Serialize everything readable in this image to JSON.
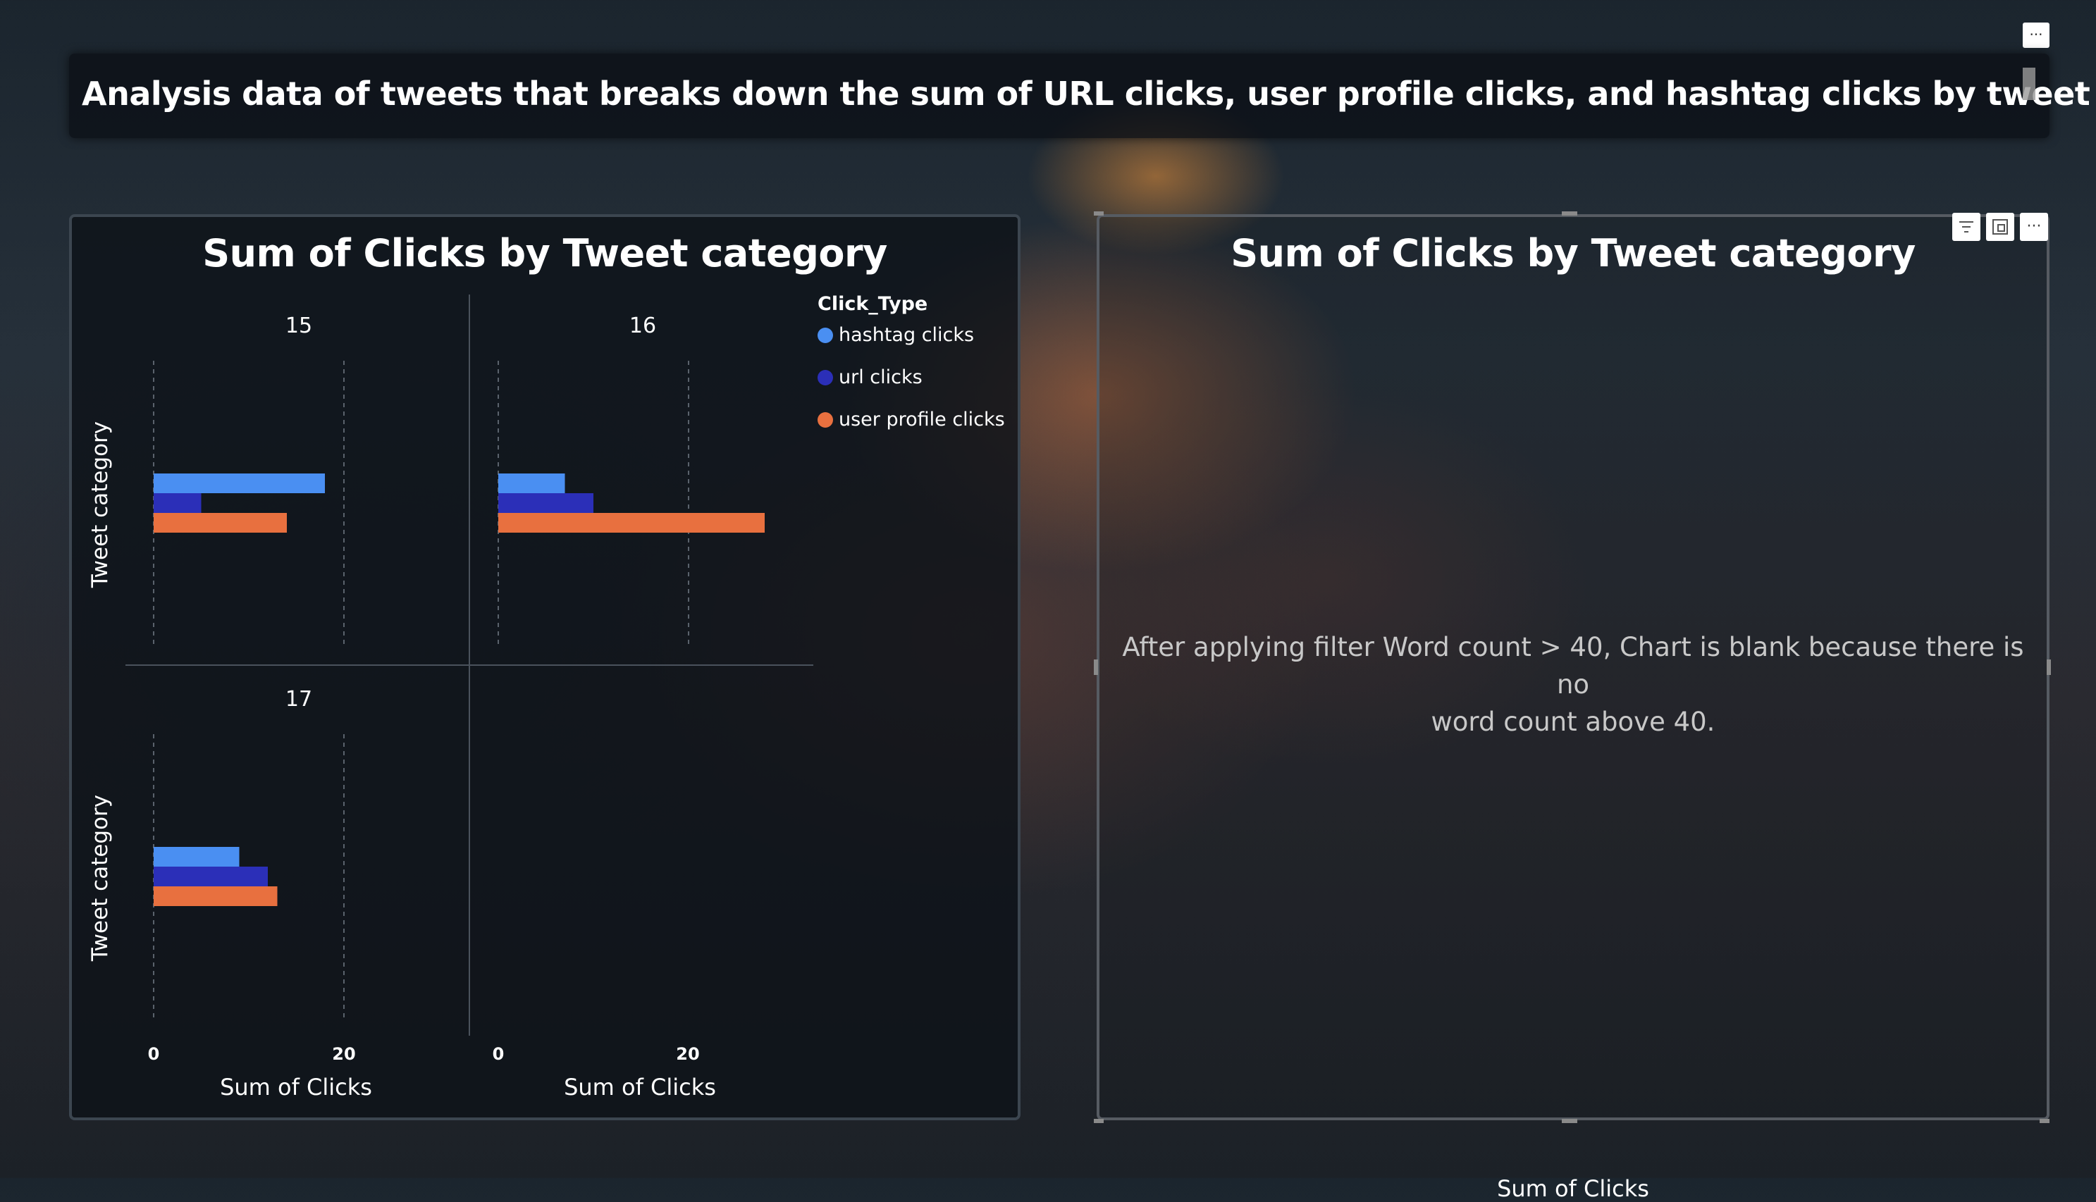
{
  "page": {
    "header_title": "Analysis data of tweets that breaks down the sum of URL clicks, user profile clicks, and hashtag clicks by tweet",
    "more_options_glyph": "···"
  },
  "colors": {
    "hashtag_clicks": "#4a8ff2",
    "url_clicks": "#2b2fb8",
    "user_profile_clicks": "#e8703f"
  },
  "left_chart": {
    "title": "Sum of Clicks by Tweet category",
    "legend_title": "Click_Type",
    "y_axis_label": "Tweet category",
    "x_axis_label": "Sum of Clicks"
  },
  "right_chart": {
    "title": "Sum of Clicks by Tweet category",
    "blank_message_line1": "After applying filter Word count > 40, Chart is blank because there is no",
    "blank_message_line2": "word count above 40.",
    "x_axis_label": "Sum of Clicks",
    "toolbar_icons": [
      "filter-icon",
      "focus-mode-icon",
      "more-options-icon"
    ]
  },
  "chart_data": [
    {
      "type": "bar",
      "orientation": "horizontal",
      "small_multiples": true,
      "title": "Sum of Clicks by Tweet category",
      "xlabel": "Sum of Clicks",
      "ylabel": "Tweet category",
      "xlim": [
        0,
        28
      ],
      "x_ticks": [
        "0",
        "20"
      ],
      "legend": {
        "title": "Click_Type",
        "position": "top-right"
      },
      "series_names": [
        "hashtag clicks",
        "url clicks",
        "user profile clicks"
      ],
      "panels": [
        {
          "label": "15",
          "values": {
            "hashtag clicks": 18,
            "url clicks": 5,
            "user profile clicks": 14
          }
        },
        {
          "label": "16",
          "values": {
            "hashtag clicks": 7,
            "url clicks": 10,
            "user profile clicks": 28
          }
        },
        {
          "label": "17",
          "values": {
            "hashtag clicks": 9,
            "url clicks": 12,
            "user profile clicks": 13
          }
        }
      ]
    },
    {
      "type": "bar",
      "title": "Sum of Clicks by Tweet category",
      "xlabel": "Sum of Clicks",
      "values": []
    }
  ]
}
